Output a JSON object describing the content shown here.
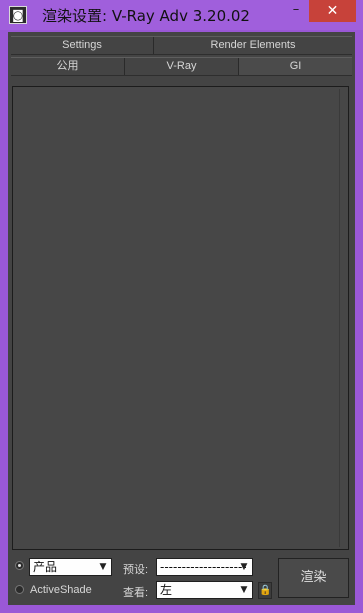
{
  "window": {
    "title": "渲染设置: V-Ray Adv 3.20.02",
    "app_icon": "3ds-max-icon",
    "minimize_glyph": "–",
    "close_glyph": "✕"
  },
  "tabs": {
    "row1": [
      "Settings",
      "Render Elements"
    ],
    "row2": [
      "公用",
      "V-Ray",
      "GI"
    ]
  },
  "bottom": {
    "mode_options": [
      "产品",
      "ActiveShade"
    ],
    "mode_selected": "产品",
    "activeshade_label": "ActiveShade",
    "preset_label": "预设:",
    "preset_value": "--------------------",
    "view_label": "查看:",
    "view_value": "左",
    "render_label": "渲染",
    "lock_icon": "lock-icon"
  },
  "colors": {
    "title_bar": "#a05fdc",
    "close_button": "#c7423a",
    "panel_bg": "#444444"
  }
}
